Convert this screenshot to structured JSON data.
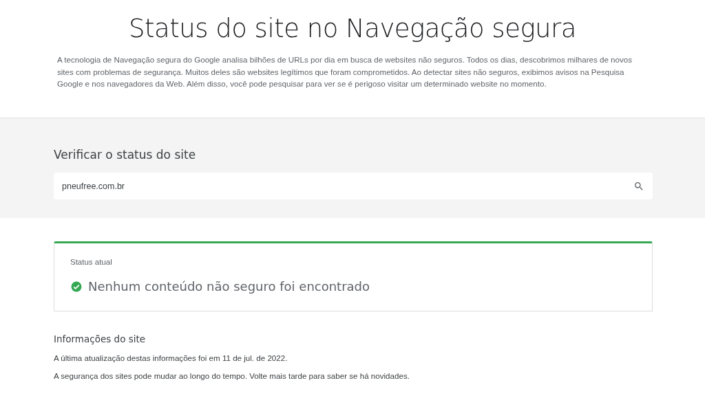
{
  "title": "Status do site no Navegação segura",
  "intro": "A tecnologia de Navegação segura do Google analisa bilhões de URLs por dia em busca de websites não seguros. Todos os dias, descobrimos milhares de novos sites com problemas de segurança. Muitos deles são websites legítimos que foram comprometidos. Ao detectar sites não seguros, exibimos avisos na Pesquisa Google e nos navegadores da Web. Além disso, você pode pesquisar para ver se é perigoso visitar um determinado website no momento.",
  "check": {
    "heading": "Verificar o status do site",
    "value": "pneufree.com.br"
  },
  "status": {
    "label": "Status atual",
    "message": "Nenhum conteúdo não seguro foi encontrado",
    "kind": "safe"
  },
  "site_info": {
    "heading": "Informações do site",
    "lines": [
      "A última atualização destas informações foi em 11 de jul. de 2022.",
      "A segurança dos sites pode mudar ao longo do tempo. Volte mais tarde para saber se há novidades."
    ]
  }
}
